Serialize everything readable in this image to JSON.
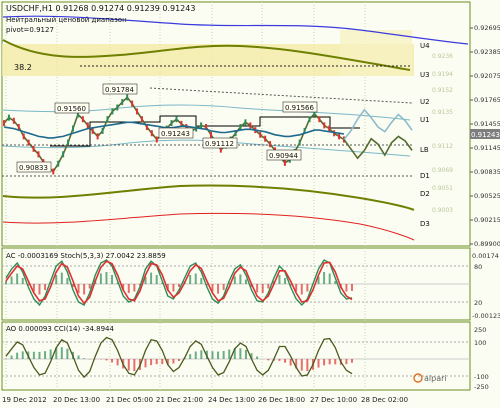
{
  "colors": {
    "background": "#fbfdf2",
    "border": "#6b8e23",
    "grid": "#c8d6a8",
    "price": "#556b2f",
    "forecast": "#8fbccc",
    "ema": "#1f6b8f",
    "kijun": "#000000",
    "envelope_olive": "#6f7f00",
    "envelope_blue": "#3a3adf",
    "envelope_red": "#e02020",
    "zone": "#f3eaa0",
    "stoch_main": "#2e8b57",
    "stoch_signal": "#e03030",
    "ac_up": "#2e8b57",
    "ac_down": "#e03030",
    "price_tag": "#7e7e7e"
  },
  "main_panel": {
    "symbol_line": "USDCHF,H1  0.91268 0.91274 0.91239 0.91243",
    "pivot_lines": [
      "Нейтральный ценовой диапазон",
      "pivot=0.9127"
    ],
    "fib_label": "38.2",
    "current_price": "0.91243",
    "price_axis": [
      "0.92695",
      "0.92385",
      "0.92075",
      "0.91765",
      "0.91455",
      "0.91145",
      "0.90835",
      "0.90525",
      "0.90215",
      "0.89900"
    ],
    "level_labels": [
      "U4",
      "U3",
      "U2",
      "D1",
      "LB",
      "D1",
      "D2",
      "D3",
      "U1"
    ],
    "level_prices_faint": [
      "0.9236",
      "0.9194",
      "0.9152",
      "0.9135",
      "0.9112",
      "0.9069",
      "0.9051",
      "0.9003"
    ],
    "marks": [
      "0.91784",
      "0.91560",
      "0.91566",
      "0.91243",
      "0.91112",
      "0.90944",
      "0.90833"
    ]
  },
  "ac_panel": {
    "title": "AC -0.0003169  Stoch(5,3,3) 27.0042 23.8859",
    "axis": [
      "0.00174",
      "80",
      "20",
      "-0.00123"
    ]
  },
  "ao_panel": {
    "title": "AO 0.000093  CCI(14) -34.8944",
    "axis": [
      "250",
      "100",
      "-100",
      "-250"
    ],
    "logo": "alpari"
  },
  "x_axis": [
    "19 Dec 2012",
    "20 Dec 13:00",
    "21 Dec 05:00",
    "21 Dec 21:00",
    "24 Dec 13:00",
    "26 Dec 18:00",
    "27 Dec 10:00",
    "28 Dec 02:00"
  ],
  "chart_data": {
    "type": "line",
    "title": "USDCHF,H1",
    "series": [
      {
        "name": "USDCHF",
        "values": [
          0.9145,
          0.9152,
          0.9148,
          0.914,
          0.9128,
          0.912,
          0.9112,
          0.9105,
          0.9095,
          0.9088,
          0.9083,
          0.9093,
          0.9105,
          0.912,
          0.9138,
          0.9156,
          0.915,
          0.9142,
          0.9135,
          0.9128,
          0.9135,
          0.915,
          0.916,
          0.9165,
          0.9172,
          0.9178,
          0.917,
          0.916,
          0.915,
          0.914,
          0.9132,
          0.9124,
          0.913,
          0.9138,
          0.9145,
          0.915,
          0.9144,
          0.914,
          0.9135,
          0.9138,
          0.9142,
          0.914,
          0.913,
          0.912,
          0.9111,
          0.9116,
          0.9124,
          0.9132,
          0.914,
          0.9146,
          0.9142,
          0.9136,
          0.913,
          0.9125,
          0.9118,
          0.911,
          0.9102,
          0.9094,
          0.9098,
          0.9108,
          0.912,
          0.9135,
          0.915,
          0.9157,
          0.915,
          0.9142,
          0.9138,
          0.9132,
          0.9128,
          0.9124
        ]
      },
      {
        "name": "forecast_1",
        "values": [
          0.9124,
          0.9135,
          0.915,
          0.9162,
          0.9152,
          0.914,
          0.9134,
          0.9146,
          0.9156,
          0.9148,
          0.9136
        ]
      },
      {
        "name": "forecast_2",
        "values": [
          0.9124,
          0.9112,
          0.91,
          0.911,
          0.9125,
          0.9118,
          0.9104,
          0.912,
          0.9128,
          0.9122,
          0.911
        ]
      },
      {
        "name": "EMA",
        "values": [
          0.914,
          0.9139,
          0.9138,
          0.9136,
          0.9134,
          0.9132,
          0.913,
          0.9128,
          0.9127,
          0.9126,
          0.9126,
          0.9127,
          0.9128,
          0.913,
          0.9132,
          0.9134,
          0.9136,
          0.9138,
          0.9139,
          0.914,
          0.9141,
          0.9142,
          0.9143,
          0.9144,
          0.9145,
          0.9146,
          0.9146,
          0.9145,
          0.9144,
          0.9143,
          0.9142,
          0.9141,
          0.914,
          0.9139,
          0.9139,
          0.914,
          0.9141,
          0.9141,
          0.914,
          0.9139,
          0.9138,
          0.9137,
          0.9135,
          0.9134,
          0.9133,
          0.9133,
          0.9134,
          0.9135,
          0.9136,
          0.9137,
          0.9137,
          0.9136,
          0.9135,
          0.9134,
          0.9132,
          0.913,
          0.9129,
          0.9128,
          0.9128,
          0.9129,
          0.913,
          0.9132,
          0.9134,
          0.9136,
          0.9136,
          0.9135,
          0.9134,
          0.9133,
          0.9132,
          0.9131
        ]
      }
    ],
    "stoch_main": [
      60,
      75,
      85,
      70,
      45,
      25,
      15,
      30,
      55,
      80,
      88,
      70,
      40,
      20,
      15,
      35,
      65,
      85,
      90,
      80,
      55,
      30,
      20,
      25,
      45,
      75,
      88,
      80,
      55,
      30,
      25,
      40,
      60,
      80,
      85,
      70,
      45,
      25,
      18,
      30,
      55,
      75,
      82,
      65,
      40,
      22,
      20,
      35,
      60,
      80,
      70,
      45,
      25,
      15,
      25,
      50,
      75,
      90,
      85,
      60,
      35,
      25,
      27
    ],
    "stoch_signal": [
      55,
      68,
      80,
      75,
      55,
      35,
      22,
      25,
      45,
      70,
      84,
      78,
      55,
      30,
      18,
      28,
      55,
      78,
      88,
      84,
      65,
      40,
      25,
      22,
      38,
      65,
      84,
      82,
      65,
      40,
      28,
      35,
      52,
      72,
      82,
      76,
      55,
      35,
      22,
      26,
      45,
      68,
      78,
      72,
      50,
      30,
      22,
      30,
      50,
      72,
      72,
      55,
      35,
      20,
      22,
      40,
      65,
      85,
      86,
      70,
      45,
      30,
      24
    ]
  }
}
